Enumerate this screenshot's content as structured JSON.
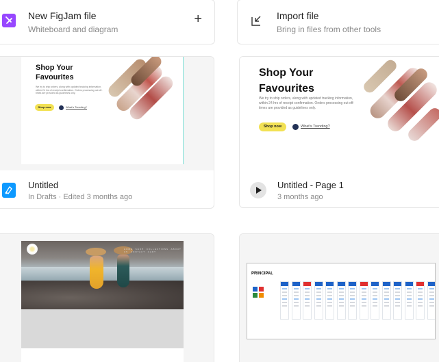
{
  "actions": {
    "new_figjam": {
      "title": "New FigJam file",
      "subtitle": "Whiteboard and diagram",
      "plus": "+",
      "icon": "figjam-file-icon",
      "icon_color": "#9747ff"
    },
    "import": {
      "title": "Import file",
      "subtitle": "Bring in files from other tools",
      "icon": "import-file-icon"
    }
  },
  "files": [
    {
      "title": "Untitled",
      "meta": "In Drafts · Edited 3 months ago",
      "icon": "figma-design-file-icon",
      "icon_color": "#0d99ff",
      "preview": {
        "heading_line1": "Shop Your",
        "heading_line2": "Favourites",
        "body": "We try to ship orders, along with updated tracking information, within 24 hrs of receipt confirmation. Orders processing out off-times are provided as guidelines only.",
        "button": "Shop now",
        "link": "What's Trending?"
      }
    },
    {
      "title": "Untitled - Page 1",
      "meta": "3 months ago",
      "icon": "play-icon",
      "preview": {
        "heading_line1": "Shop Your",
        "heading_line2": "Favourites",
        "body": "We try to ship orders, along with updated tracking information, within 24 hrs of receipt confirmation. Orders processing out off-times are provided as guidelines only.",
        "button": "Shop now",
        "link": "What's Trending?"
      }
    },
    {
      "preview": {
        "nav_items": [
          "HOME",
          "SHOP",
          "COLLECTIONS",
          "ABOUT US",
          "CONTACT",
          "CART"
        ]
      }
    },
    {
      "preview": {
        "board_title": "PRINCIPAL"
      }
    }
  ],
  "colors": {
    "accent_yellow": "#f2e154",
    "navy": "#233156",
    "card_border": "#e6e6e6",
    "muted_text": "#8a8a8a"
  }
}
